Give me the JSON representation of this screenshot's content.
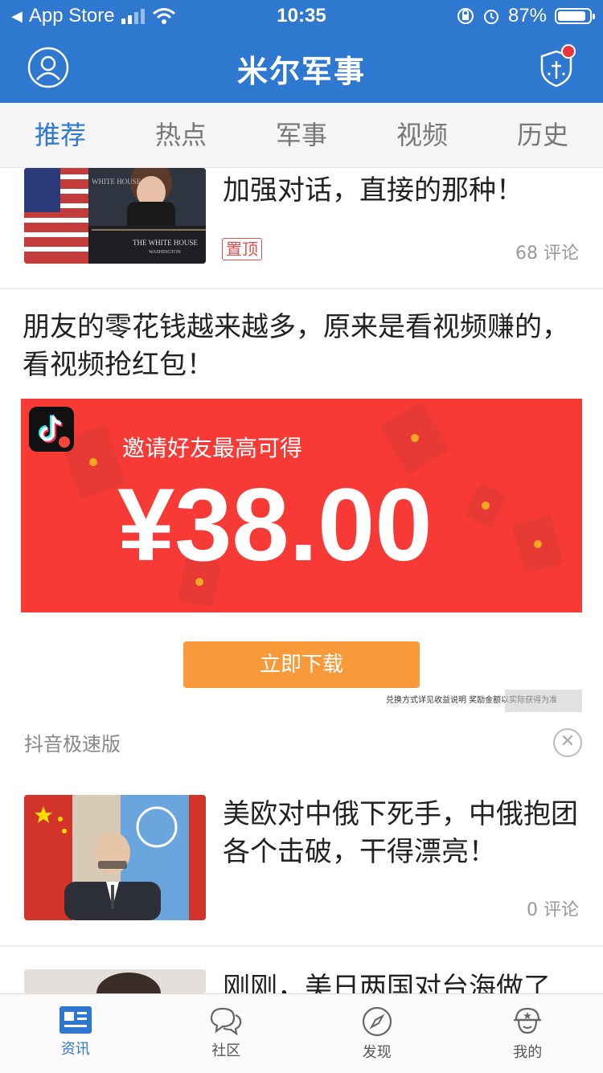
{
  "status_bar": {
    "back_app": "App Store",
    "time": "10:35",
    "battery": "87%"
  },
  "header": {
    "title": "米尔军事"
  },
  "tabs": [
    {
      "label": "推荐",
      "active": true
    },
    {
      "label": "热点"
    },
    {
      "label": "军事"
    },
    {
      "label": "视频"
    },
    {
      "label": "历史"
    }
  ],
  "feed": {
    "item1": {
      "title_line": "加强对话，直接的那种！",
      "badge": "置顶",
      "comments": "68 评论"
    },
    "ad": {
      "title": "朋友的零花钱越来越多，原来是看视频赚的，看视频抢红包！",
      "banner_caption": "邀请好友最高可得",
      "amount": "¥38.00",
      "button": "立即下载",
      "fine_print": "兑换方式详见收益说明 奖励金额以实际获得为准",
      "source": "抖音极速版"
    },
    "item2": {
      "title": "美欧对中俄下死手，中俄抱团各个击破，干得漂亮！",
      "comments": "0 评论"
    },
    "item3": {
      "title": "刚刚，美日两国对台海做了"
    }
  },
  "bottom_nav": [
    {
      "label": "资讯",
      "icon": "news-icon",
      "active": true
    },
    {
      "label": "社区",
      "icon": "chat-bubbles-icon"
    },
    {
      "label": "发现",
      "icon": "compass-icon"
    },
    {
      "label": "我的",
      "icon": "soldier-helmet-icon"
    }
  ]
}
